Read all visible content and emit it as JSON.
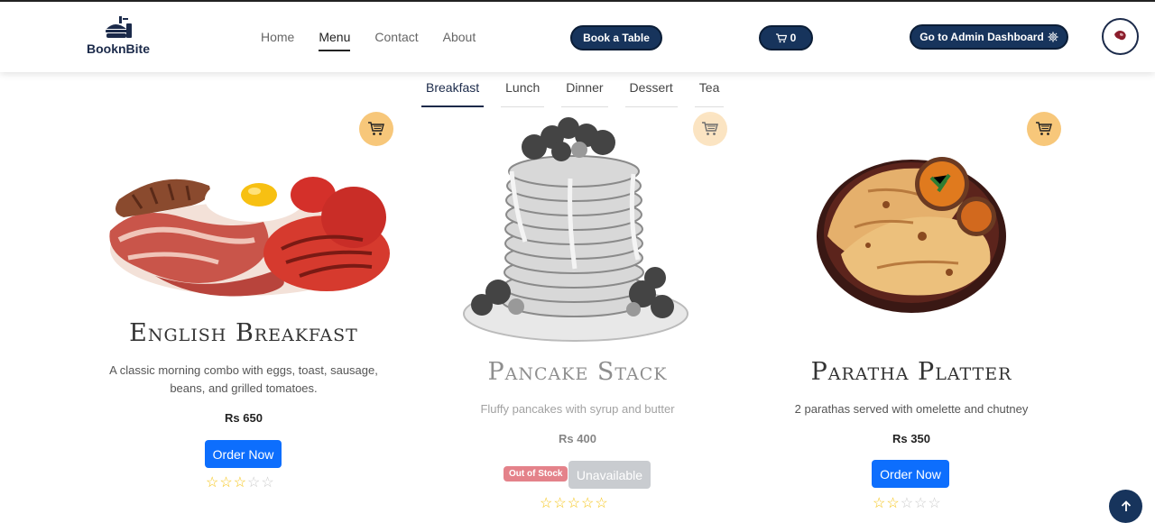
{
  "brand": {
    "name": "BooknBite"
  },
  "nav": {
    "items": [
      {
        "label": "Home",
        "active": false
      },
      {
        "label": "Menu",
        "active": true
      },
      {
        "label": "Contact",
        "active": false
      },
      {
        "label": "About",
        "active": false
      }
    ]
  },
  "header": {
    "book_label": "Book a Table",
    "cart_count": "0",
    "admin_label": "Go to Admin Dashboard"
  },
  "tabs": [
    {
      "label": "Breakfast",
      "active": true
    },
    {
      "label": "Lunch",
      "active": false
    },
    {
      "label": "Dinner",
      "active": false
    },
    {
      "label": "Dessert",
      "active": false
    },
    {
      "label": "Tea",
      "active": false
    }
  ],
  "menu_items": [
    {
      "title": "English Breakfast",
      "description": "A classic morning combo with eggs, toast, sausage, beans, and grilled tomatoes.",
      "price": "Rs 650",
      "button": "Order Now",
      "rating": 3,
      "max_rating": 5,
      "available": true
    },
    {
      "title": "Pancake Stack",
      "description": "Fluffy pancakes with syrup and butter",
      "price": "Rs 400",
      "badge": "Out of Stock",
      "button": "Unavailable",
      "rating": 0,
      "max_rating": 5,
      "available": false
    },
    {
      "title": "Paratha Platter",
      "description": "2 parathas served with omelette and chutney",
      "price": "Rs 350",
      "button": "Order Now",
      "rating": 2,
      "max_rating": 5,
      "available": true
    }
  ],
  "colors": {
    "primary_dark": "#17345c",
    "order_blue": "#0d6efd",
    "cart_circle": "#f7c77a",
    "star": "#f5c518",
    "badge_red": "#e4828a"
  }
}
